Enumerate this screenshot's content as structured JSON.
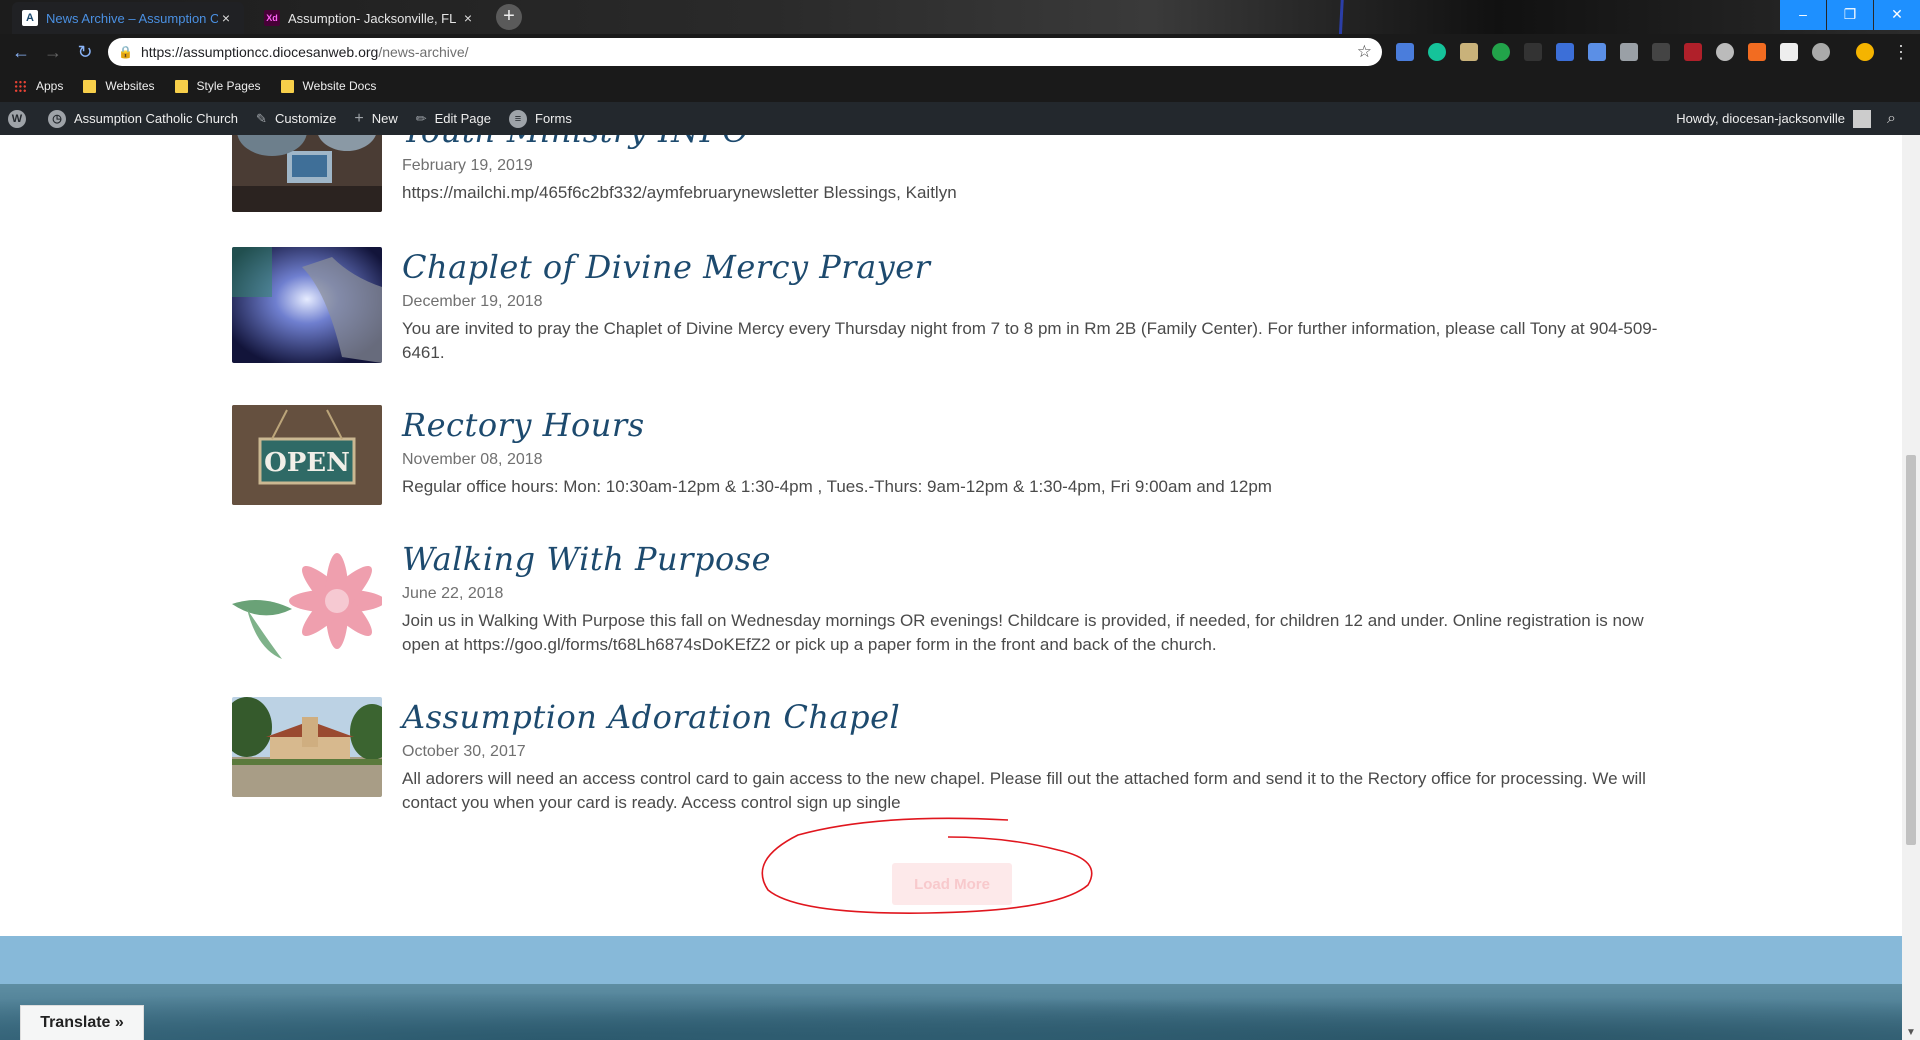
{
  "browser": {
    "tabs": [
      {
        "title": "News Archive – Assumption Cath",
        "favicon": "A",
        "active": true
      },
      {
        "title": "Assumption- Jacksonville, FL",
        "favicon": "Xd",
        "active": false
      }
    ],
    "url_host": "https://assumptioncc.diocesanweb.org",
    "url_path": "/news-archive/",
    "bookmarks": [
      "Apps",
      "Websites",
      "Style Pages",
      "Website Docs"
    ]
  },
  "adminbar": {
    "site_name": "Assumption Catholic Church",
    "customize": "Customize",
    "new": "New",
    "edit_page": "Edit Page",
    "forms": "Forms",
    "howdy": "Howdy, diocesan-jacksonville"
  },
  "news": [
    {
      "title": "Youth Ministry INFO",
      "date": "February 19, 2019",
      "excerpt": "https://mailchi.mp/465f6c2bf332/aymfebruarynewsletter Blessings, Kaitlyn"
    },
    {
      "title": "Chaplet of Divine Mercy Prayer",
      "date": "December 19, 2018",
      "excerpt": "You are invited to pray the Chaplet of Divine Mercy every Thursday night from 7 to 8 pm in Rm 2B (Family Center). For further information, please call Tony at 904-509-6461."
    },
    {
      "title": "Rectory Hours",
      "date": "November 08, 2018",
      "excerpt": "Regular office hours: Mon: 10:30am-12pm & 1:30-4pm , Tues.-Thurs: 9am-12pm & 1:30-4pm, Fri 9:00am and 12pm",
      "thumb_text": "OPEN"
    },
    {
      "title": "Walking With Purpose",
      "date": "June 22, 2018",
      "excerpt": "Join us in Walking With Purpose this fall on Wednesday mornings OR evenings! Childcare is provided, if needed, for children 12 and under. Online registration is now open at https://goo.gl/forms/t68Lh6874sDoKEfZ2 or pick up a paper form in the front and back of the church."
    },
    {
      "title": "Assumption Adoration Chapel",
      "date": "October 30, 2017",
      "excerpt": "All adorers will need an access control card to gain access to the new chapel.  Please fill out the attached form and send it to the Rectory office for processing. We will contact you when your card is ready. Access control sign up single"
    }
  ],
  "load_more_label": "Load More",
  "translate_label": "Translate »",
  "colors": {
    "title_blue": "#1d4a6e",
    "footer_band": "#87b9d9",
    "annotation_red": "#e0161e"
  }
}
